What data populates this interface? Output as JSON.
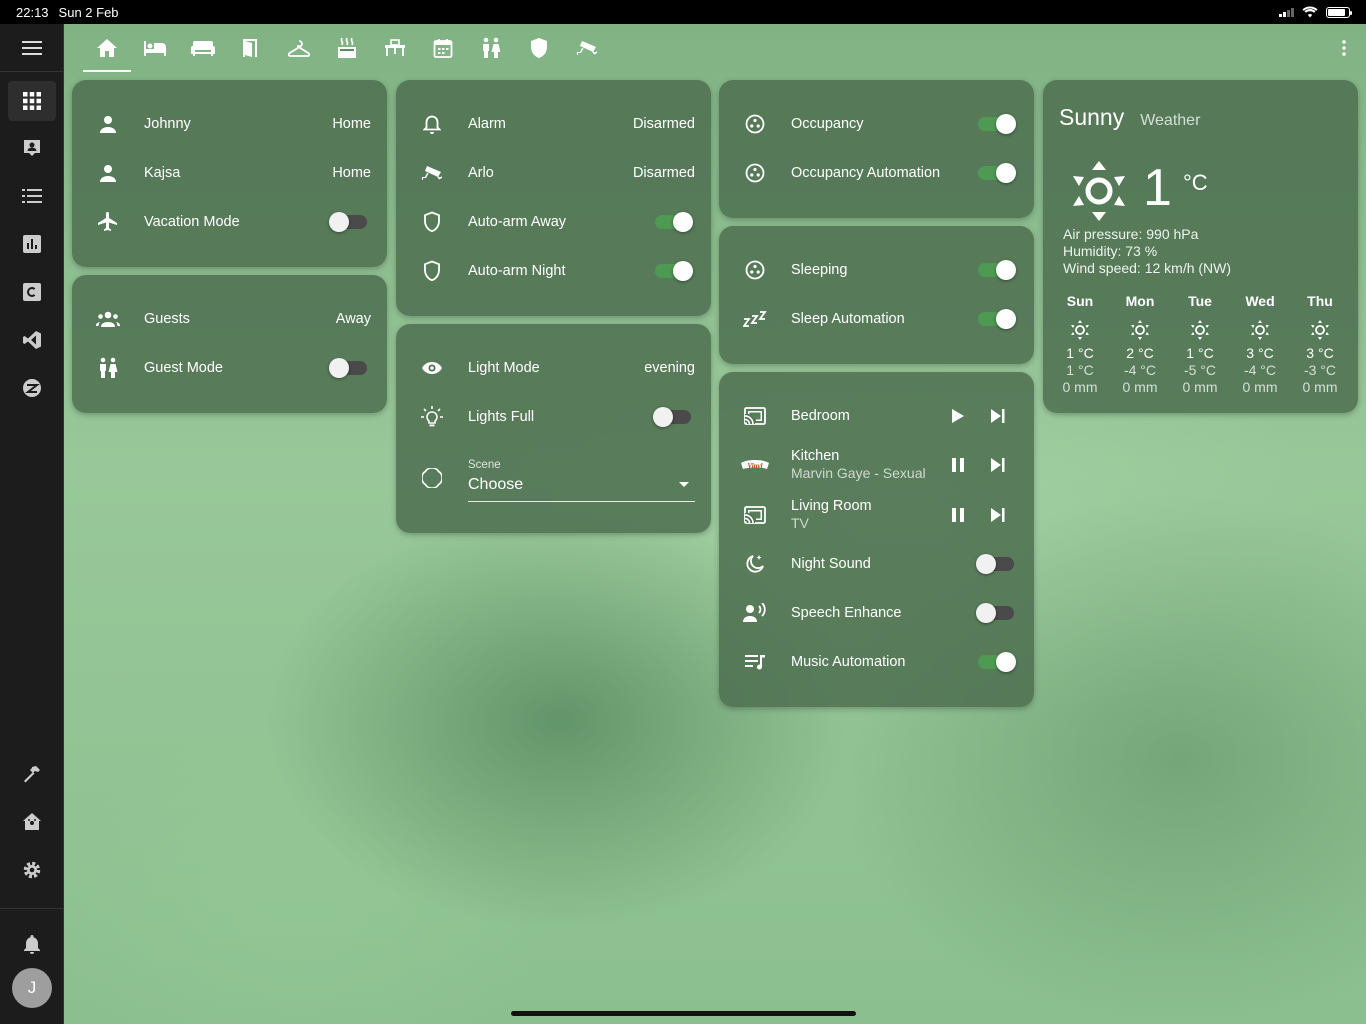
{
  "status": {
    "time": "22:13",
    "date": "Sun 2 Feb"
  },
  "sidebar": {
    "avatar_letter": "J"
  },
  "people_card": {
    "rows": [
      {
        "name": "Johnny",
        "state": "Home"
      },
      {
        "name": "Kajsa",
        "state": "Home"
      },
      {
        "name": "Vacation Mode",
        "toggle": false
      }
    ]
  },
  "guests_card": {
    "rows": [
      {
        "name": "Guests",
        "state": "Away"
      },
      {
        "name": "Guest Mode",
        "toggle": false
      }
    ]
  },
  "alarm_card": {
    "rows": [
      {
        "name": "Alarm",
        "state": "Disarmed"
      },
      {
        "name": "Arlo",
        "state": "Disarmed"
      },
      {
        "name": "Auto-arm Away",
        "toggle": true
      },
      {
        "name": "Auto-arm Night",
        "toggle": true
      }
    ]
  },
  "light_card": {
    "rows": [
      {
        "name": "Light Mode",
        "state": "evening"
      },
      {
        "name": "Lights Full",
        "toggle": false
      }
    ],
    "scene": {
      "label": "Scene",
      "value": "Choose"
    }
  },
  "occupancy_card": {
    "rows": [
      {
        "name": "Occupancy",
        "toggle": true
      },
      {
        "name": "Occupancy Automation",
        "toggle": true
      }
    ]
  },
  "sleep_card": {
    "rows": [
      {
        "name": "Sleeping",
        "toggle": true
      },
      {
        "name": "Sleep Automation",
        "toggle": true
      }
    ]
  },
  "media_card": {
    "players": [
      {
        "name": "Bedroom",
        "sub": "",
        "playing": false
      },
      {
        "name": "Kitchen",
        "sub": "Marvin Gaye - Sexual H",
        "playing": true
      },
      {
        "name": "Living Room",
        "sub": "TV",
        "playing": true
      }
    ],
    "rows": [
      {
        "name": "Night Sound",
        "toggle": false
      },
      {
        "name": "Speech Enhance",
        "toggle": false
      },
      {
        "name": "Music Automation",
        "toggle": true
      }
    ],
    "logo_text": "Vinyl"
  },
  "weather": {
    "condition": "Sunny",
    "label": "Weather",
    "temperature": "1",
    "unit": "°C",
    "air_pressure": "Air pressure: 990 hPa",
    "humidity": "Humidity: 73 %",
    "wind": "Wind speed: 12 km/h (NW)",
    "forecast": [
      {
        "day": "Sun",
        "high": "1 °C",
        "low": "1 °C",
        "precip": "0 mm"
      },
      {
        "day": "Mon",
        "high": "2 °C",
        "low": "-4 °C",
        "precip": "0 mm"
      },
      {
        "day": "Tue",
        "high": "1 °C",
        "low": "-5 °C",
        "precip": "0 mm"
      },
      {
        "day": "Wed",
        "high": "3 °C",
        "low": "-4 °C",
        "precip": "0 mm"
      },
      {
        "day": "Thu",
        "high": "3 °C",
        "low": "-3 °C",
        "precip": "0 mm"
      }
    ]
  }
}
